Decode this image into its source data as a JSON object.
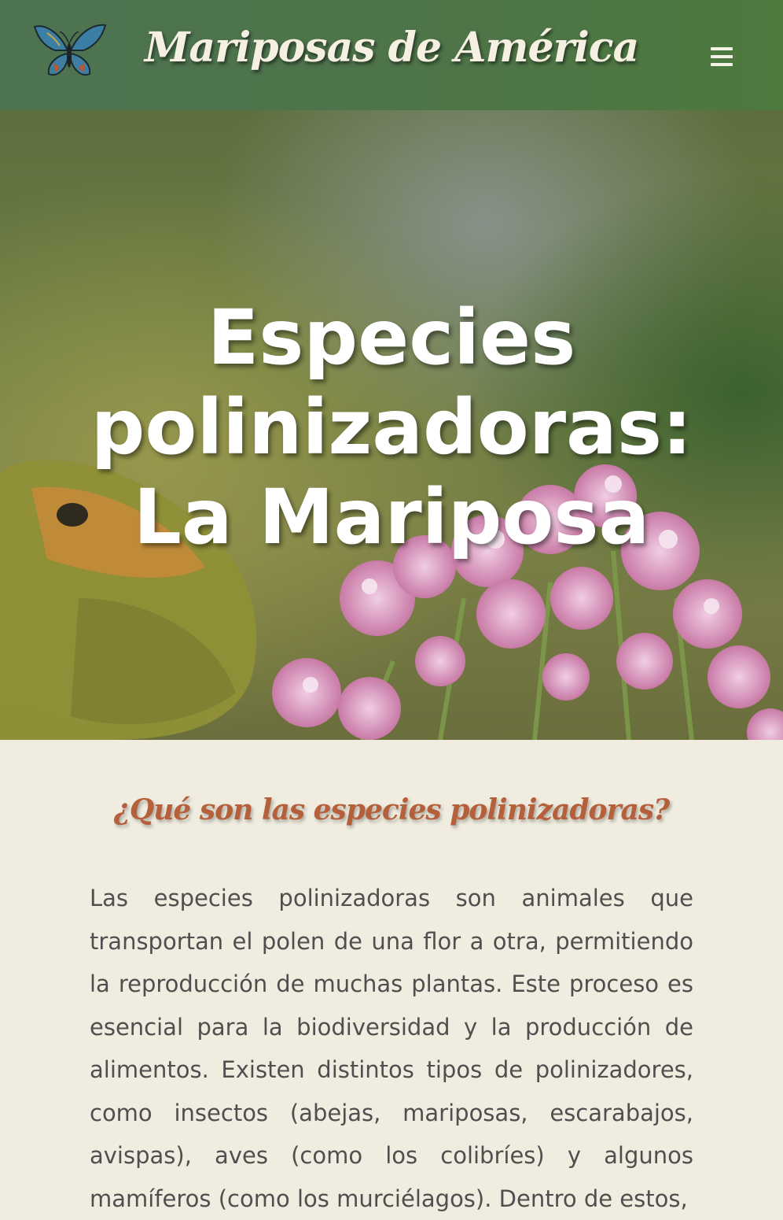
{
  "header": {
    "site_title": "Mariposas de América",
    "logo_icon": "butterfly-logo-icon",
    "menu_icon": "hamburger-menu-icon"
  },
  "hero": {
    "title": "Especies polinizadoras: La Mariposa"
  },
  "main": {
    "section_heading": "¿Qué son las especies polinizadoras?",
    "paragraph": "Las especies polinizadoras son animales que transportan el polen de una flor a otra, permitiendo la reproducción de muchas plantas. Este proceso es esencial para la biodiversidad y la producción de alimentos. Existen distintos tipos de polinizadores, como insectos (abejas, mariposas, escarabajos, avispas), aves (como los colibríes) y algunos mamíferos (como los murciélagos). Dentro de estos,"
  },
  "colors": {
    "header_green": "#4e7448",
    "page_background": "#f0ede0",
    "heading_orange": "#b5603a",
    "body_text": "#4f4f4f"
  }
}
